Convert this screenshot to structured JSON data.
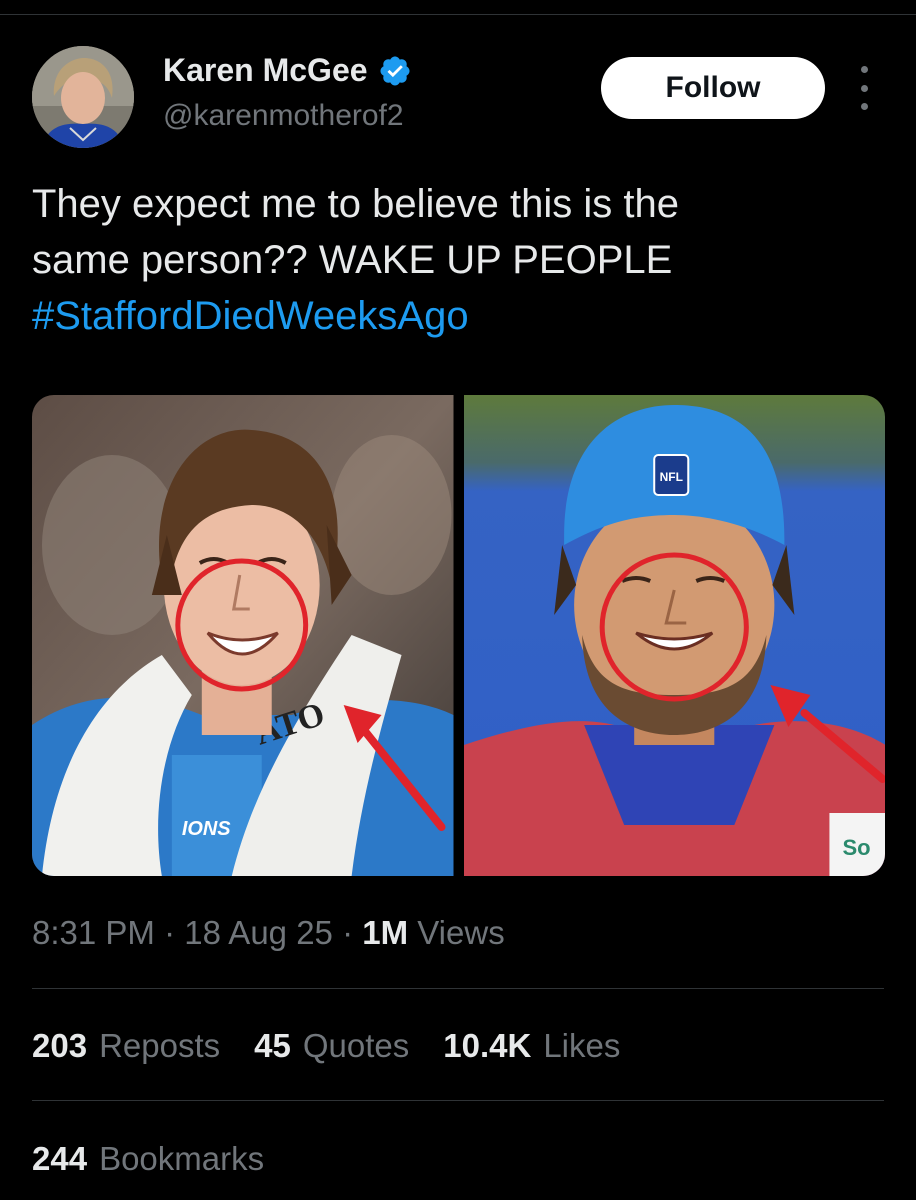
{
  "author": {
    "name": "Karen McGee",
    "handle": "@karenmotherof2",
    "verified": true
  },
  "follow_label": "Follow",
  "tweet": {
    "line1": "They expect me to believe this is the",
    "line2": "same person?? WAKE UP PEOPLE",
    "hashtag": "#StaffordDiedWeeksAgo"
  },
  "media": {
    "left_photo": {
      "jersey_text": "IONS",
      "towel_text": "ATO"
    },
    "right_photo": {
      "cap_logo": "NFL",
      "sponsor_text": "So"
    }
  },
  "meta": {
    "time": "8:31 PM",
    "sep1": "·",
    "date": "18 Aug 25",
    "sep2": "·",
    "views_count": "1M",
    "views_label": "Views"
  },
  "stats": {
    "reposts_count": "203",
    "reposts_label": "Reposts",
    "quotes_count": "45",
    "quotes_label": "Quotes",
    "likes_count": "10.4K",
    "likes_label": "Likes",
    "bookmarks_count": "244",
    "bookmarks_label": "Bookmarks"
  },
  "colors": {
    "background": "#000000",
    "text": "#e7e9ea",
    "muted": "#71767b",
    "accent": "#1d9bf0",
    "annotation_red": "#e0242b"
  },
  "icons": {
    "verified": "verified-badge-icon",
    "more": "more-vertical-icon"
  }
}
